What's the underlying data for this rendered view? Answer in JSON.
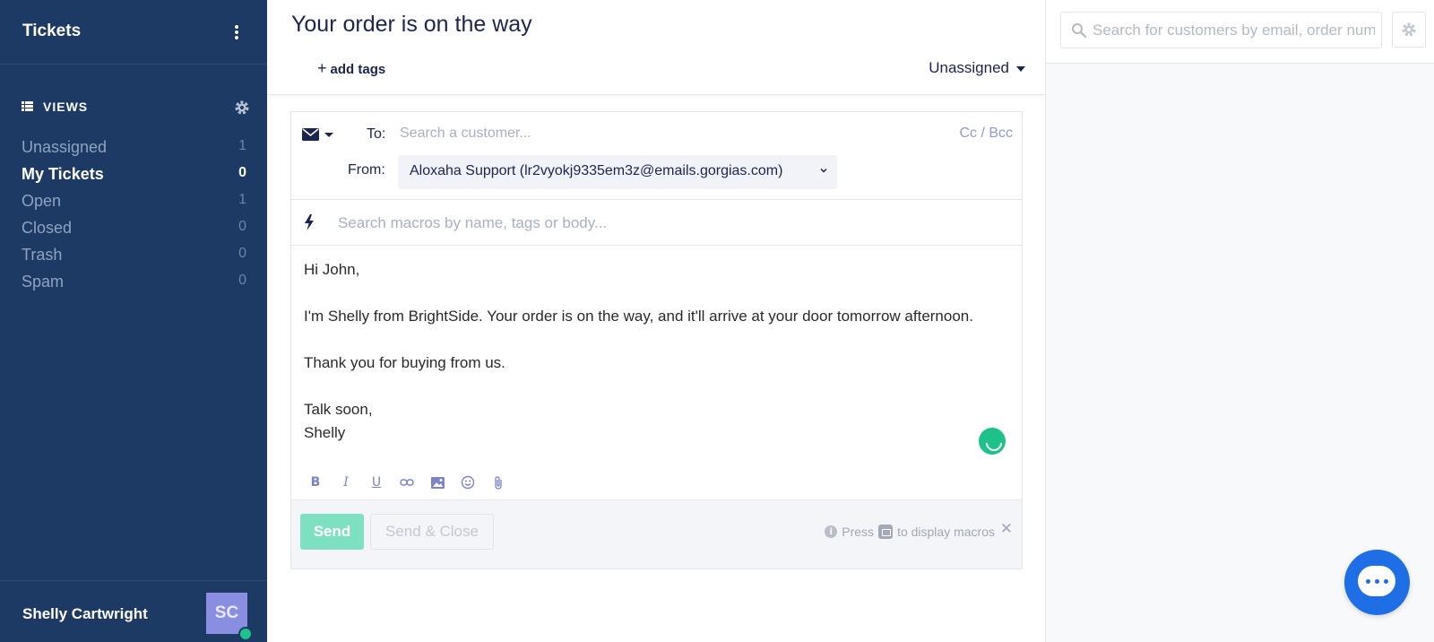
{
  "sidebar": {
    "title": "Tickets",
    "views_label": "VIEWS",
    "views": [
      {
        "label": "Unassigned",
        "count": "1"
      },
      {
        "label": "My Tickets",
        "count": "0"
      },
      {
        "label": "Open",
        "count": "1"
      },
      {
        "label": "Closed",
        "count": "0"
      },
      {
        "label": "Trash",
        "count": "0"
      },
      {
        "label": "Spam",
        "count": "0"
      }
    ],
    "active_view": "My Tickets",
    "user_name": "Shelly Cartwright",
    "avatar_initials": "SC",
    "user_status": "online"
  },
  "ticket": {
    "title": "Your order is on the way",
    "add_tags": "add tags",
    "assignee": "Unassigned"
  },
  "composer": {
    "to_label": "To:",
    "to_placeholder": "Search a customer...",
    "cc_bcc": "Cc / Bcc",
    "from_label": "From:",
    "from_value": "Aloxaha Support (lr2vyokj9335em3z@emails.gorgias.com)",
    "macro_placeholder": "Search macros by name, tags or body...",
    "body": "Hi John,\n\nI'm Shelly from BrightSide. Your order is on the way, and it'll arrive at your door tomorrow afternoon.\n\nThank you for buying from us.\n\nTalk soon,\nShelly",
    "send_label": "Send",
    "send_close_label": "Send & Close",
    "hint_press": "Press",
    "hint_rest": "to display macros"
  },
  "right_panel": {
    "search_placeholder": "Search for customers by email, order number"
  },
  "colors": {
    "sidebar_bg": "#1c3a63",
    "accent_green": "#1ec38b",
    "send_button": "#7de0c0",
    "chat_blue": "#1e6fe6"
  }
}
